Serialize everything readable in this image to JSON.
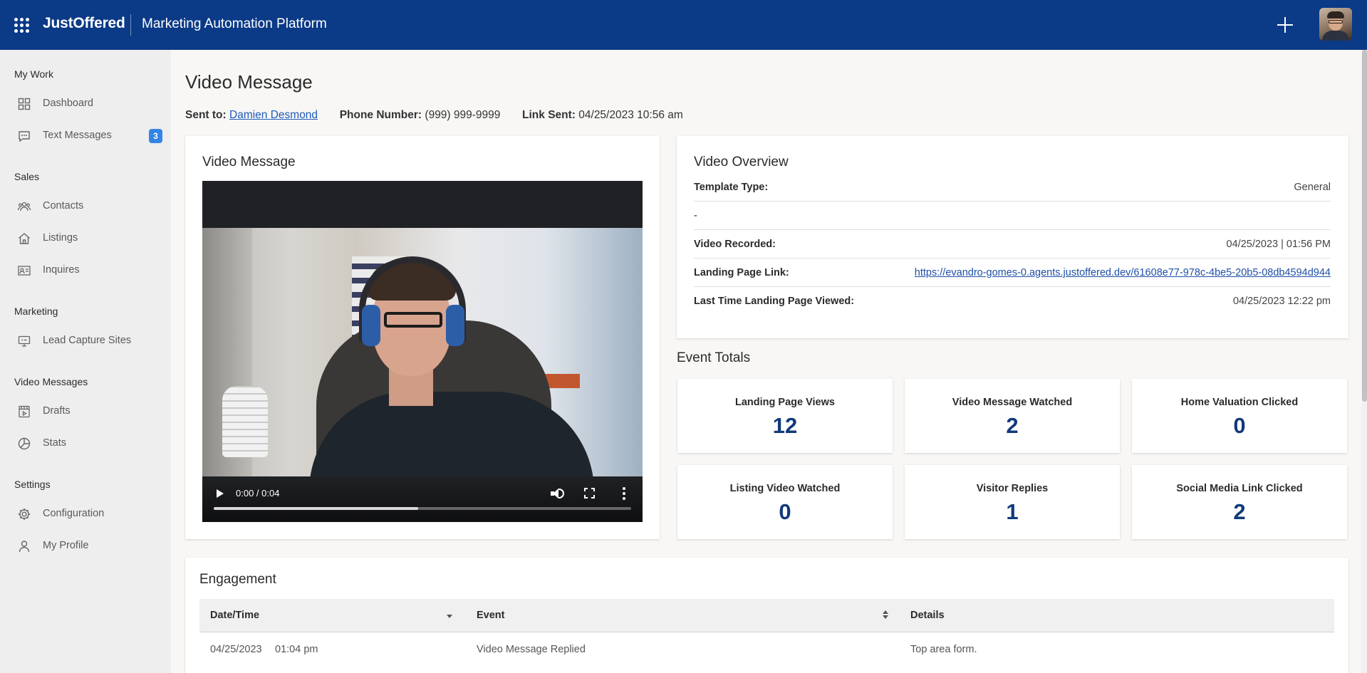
{
  "app": {
    "brand": "JustOffered",
    "platform_title": "Marketing Automation Platform"
  },
  "sidebar": {
    "sections": [
      {
        "title": "My Work",
        "items": [
          {
            "label": "Dashboard",
            "icon": "dashboard-icon"
          },
          {
            "label": "Text Messages",
            "icon": "chat-icon",
            "badge": "3"
          }
        ]
      },
      {
        "title": "Sales",
        "items": [
          {
            "label": "Contacts",
            "icon": "contacts-icon"
          },
          {
            "label": "Listings",
            "icon": "home-icon"
          },
          {
            "label": "Inquires",
            "icon": "id-card-icon"
          }
        ]
      },
      {
        "title": "Marketing",
        "items": [
          {
            "label": "Lead Capture Sites",
            "icon": "monitor-icon"
          }
        ]
      },
      {
        "title": "Video Messages",
        "items": [
          {
            "label": "Drafts",
            "icon": "drafts-icon"
          },
          {
            "label": "Stats",
            "icon": "pie-chart-icon"
          }
        ]
      },
      {
        "title": "Settings",
        "items": [
          {
            "label": "Configuration",
            "icon": "gear-icon"
          },
          {
            "label": "My Profile",
            "icon": "user-icon"
          }
        ]
      }
    ]
  },
  "page": {
    "title": "Video Message",
    "sent_to_label": "Sent to:",
    "sent_to_value": "Damien Desmond",
    "phone_label": "Phone Number:",
    "phone_value": "(999) 999-9999",
    "link_sent_label": "Link Sent:",
    "link_sent_value": "04/25/2023 10:56 am"
  },
  "video_card": {
    "title": "Video Message",
    "time": "0:00 / 0:04",
    "progress_fraction": 0.49
  },
  "overview": {
    "title": "Video Overview",
    "rows": [
      {
        "label": "Template Type:",
        "value": "General"
      },
      {
        "label": "-",
        "value": ""
      },
      {
        "label": "Video Recorded:",
        "value": "04/25/2023 | 01:56 PM"
      },
      {
        "label": "Landing Page Link:",
        "value": "https://evandro-gomes-0.agents.justoffered.dev/61608e77-978c-4be5-20b5-08db4594d944"
      },
      {
        "label": "Last Time Landing Page Viewed:",
        "value": "04/25/2023 12:22 pm"
      }
    ]
  },
  "event_totals": {
    "title": "Event Totals",
    "stats": [
      {
        "label": "Landing Page Views",
        "value": "12"
      },
      {
        "label": "Video Message Watched",
        "value": "2"
      },
      {
        "label": "Home Valuation Clicked",
        "value": "0"
      },
      {
        "label": "Listing Video Watched",
        "value": "0"
      },
      {
        "label": "Visitor Replies",
        "value": "1"
      },
      {
        "label": "Social Media Link Clicked",
        "value": "2"
      }
    ]
  },
  "engagement": {
    "title": "Engagement",
    "columns": [
      "Date/Time",
      "Event",
      "Details"
    ],
    "rows": [
      {
        "date": "04/25/2023",
        "time": "01:04 pm",
        "event": "Video Message Replied",
        "details": "Top area form."
      }
    ]
  },
  "colors": {
    "topbar": "#0b3a86",
    "badge": "#3385e5",
    "stat_value": "#123a7a",
    "link": "#1f5bb8"
  }
}
